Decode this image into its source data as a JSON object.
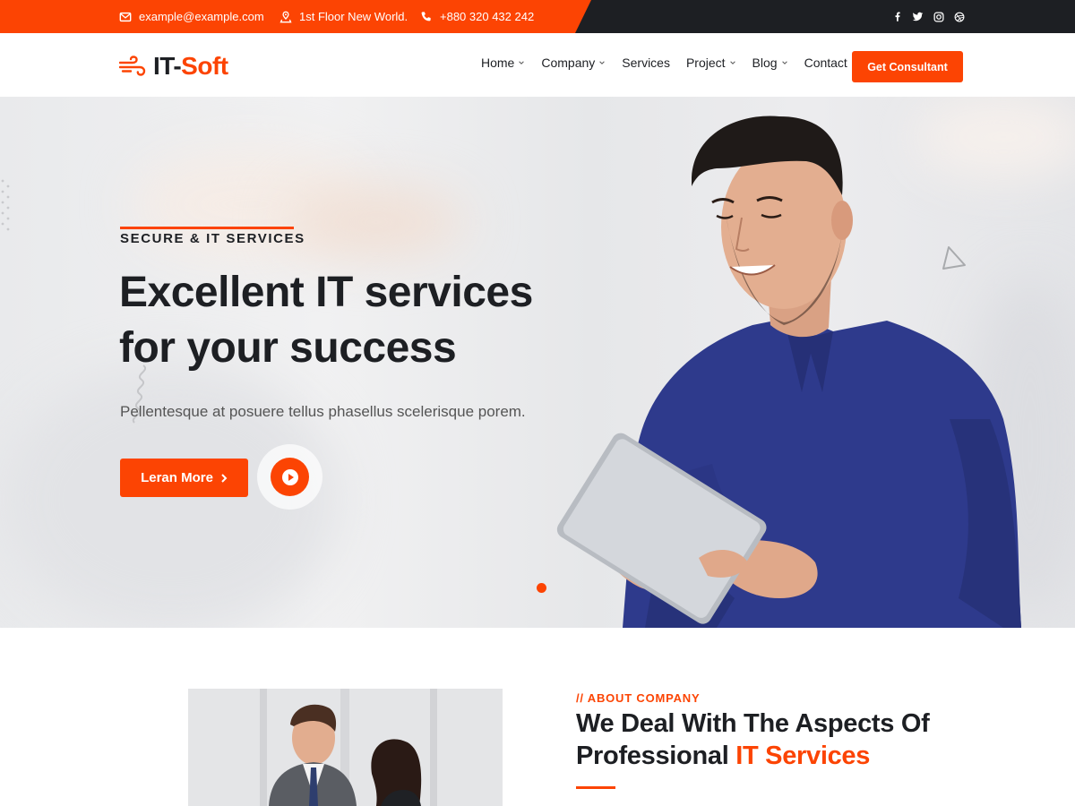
{
  "topbar": {
    "email": "example@example.com",
    "address": "1st Floor New World.",
    "phone": "+880 320 432 242",
    "social": [
      "facebook-icon",
      "twitter-icon",
      "instagram-icon",
      "dribbble-icon"
    ]
  },
  "brand": {
    "logo_part1": "IT-",
    "logo_part2": "Soft",
    "accent": "#fc4403",
    "dark": "#1d1f23"
  },
  "nav": {
    "items": [
      {
        "label": "Home",
        "dropdown": true
      },
      {
        "label": "Company",
        "dropdown": true
      },
      {
        "label": "Services",
        "dropdown": false
      },
      {
        "label": "Project",
        "dropdown": true
      },
      {
        "label": "Blog",
        "dropdown": true
      },
      {
        "label": "Contact",
        "dropdown": false
      }
    ],
    "cta": "Get Consultant"
  },
  "hero": {
    "eyebrow": "SECURE & IT SERVICES",
    "title_line1": "Excellent IT services",
    "title_line2": "for your success",
    "subtitle": "Pellentesque at posuere tellus phasellus scelerisque porem.",
    "button": "Leran More"
  },
  "about": {
    "label": "// ABOUT COMPANY",
    "title_line1": "We Deal With The Aspects Of",
    "title_line2_plain": "Professional ",
    "title_line2_highlight": "IT Services"
  }
}
